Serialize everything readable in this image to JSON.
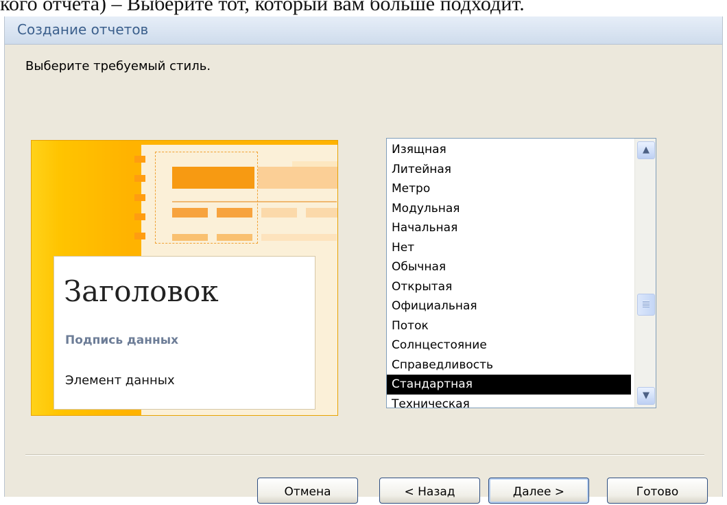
{
  "document": {
    "text_above": "кого отчета) – Выберите тот, который вам больше подходит."
  },
  "dialog": {
    "title": "Создание отчетов",
    "prompt": "Выберите требуемый стиль."
  },
  "preview": {
    "heading": "Заголовок",
    "caption": "Подпись данных",
    "element": "Элемент данных",
    "colors": {
      "accent": "#ffc400",
      "paper": "#fbf0d8",
      "bar": "#ff9d10"
    }
  },
  "style_list": {
    "items": [
      "Изящная",
      "Литейная",
      "Метро",
      "Модульная",
      "Начальная",
      "Нет",
      "Обычная",
      "Открытая",
      "Официальная",
      "Поток",
      "Солнцестояние",
      "Справедливость",
      "Стандартная",
      "Техническая"
    ],
    "selected": "Стандартная"
  },
  "buttons": {
    "cancel": "Отмена",
    "back": "< Назад",
    "next": "Далее >",
    "finish": "Готово"
  }
}
